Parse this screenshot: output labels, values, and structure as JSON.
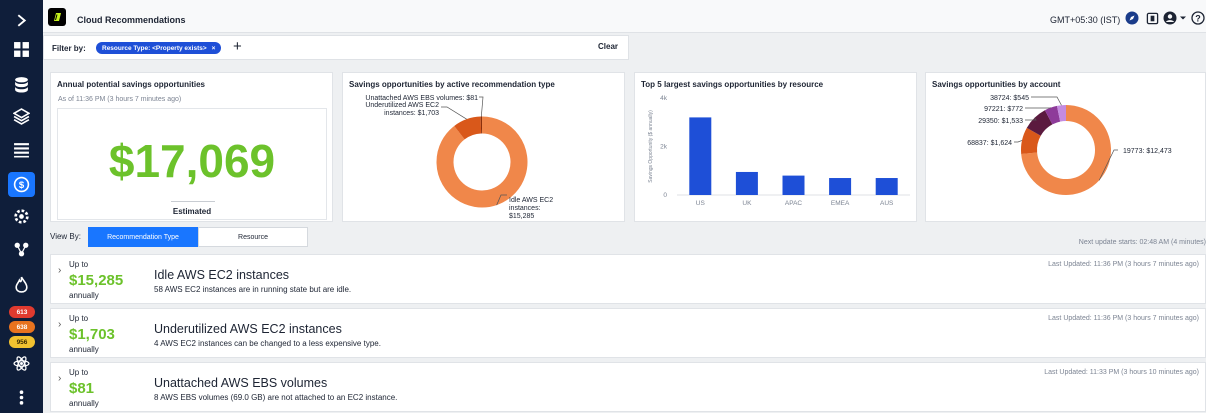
{
  "app": {
    "title": "Cloud Recommendations",
    "timezone": "GMT+05:30 (IST)"
  },
  "rail": {
    "items": [
      "expand-icon",
      "dashboard-icon",
      "database-icon",
      "layers-icon",
      "list-icon",
      "savings-icon",
      "settings-gear-icon",
      "topology-icon",
      "fire-icon"
    ],
    "badges": [
      {
        "label": "613",
        "color": "#e03a2f"
      },
      {
        "label": "638",
        "color": "#e8731f"
      },
      {
        "label": "956",
        "color": "#f2c230"
      }
    ]
  },
  "filter": {
    "label": "Filter by:",
    "chip": "Resource Type: <Property exists>",
    "chip_close": "×",
    "add": "+",
    "clear": "Clear"
  },
  "cards": {
    "annual": {
      "title": "Annual potential savings opportunities",
      "as_of": "As of 11:36 PM (3 hours 7 minutes ago)",
      "value": "$17,069",
      "caption": "Estimated"
    },
    "by_type": {
      "title": "Savings opportunities by active recommendation type"
    },
    "top5": {
      "title": "Top 5 largest savings opportunities by resource"
    },
    "by_account": {
      "title": "Savings opportunities by account"
    }
  },
  "chart_data": [
    {
      "type": "pie",
      "title": "Savings opportunities by active recommendation type",
      "slices": [
        {
          "label": "Idle AWS EC2 instances: $15,285",
          "value": 15285,
          "color": "#f0874a"
        },
        {
          "label": "Underutilized AWS EC2 instances: $1,703",
          "value": 1703,
          "color": "#d9581a"
        },
        {
          "label": "Unattached AWS EBS volumes: $81",
          "value": 81,
          "color": "#8a2f0c"
        }
      ]
    },
    {
      "type": "bar",
      "title": "Top 5 largest savings opportunities by resource",
      "categories": [
        "US",
        "UK",
        "APAC",
        "EMEA",
        "AUS"
      ],
      "values": [
        3200,
        950,
        800,
        700,
        700
      ],
      "ylabel": "Savings Opportunity ($ annually)",
      "ylim": [
        0,
        4000
      ],
      "yticks": [
        {
          "v": 0,
          "label": "0"
        },
        {
          "v": 2000,
          "label": "2k"
        },
        {
          "v": 4000,
          "label": "4k"
        }
      ],
      "color": "#1e4fd7"
    },
    {
      "type": "pie",
      "title": "Savings opportunities by account",
      "slices": [
        {
          "label": "19773: $12,473",
          "value": 12473,
          "color": "#f0874a"
        },
        {
          "label": "68837: $1,624",
          "value": 1624,
          "color": "#d9581a"
        },
        {
          "label": "29350: $1,533",
          "value": 1533,
          "color": "#5b1a3f"
        },
        {
          "label": "97221: $772",
          "value": 772,
          "color": "#8e3b9a"
        },
        {
          "label": "38724: $545",
          "value": 545,
          "color": "#c48be0"
        }
      ]
    }
  ],
  "view_by": {
    "label": "View By:",
    "options": [
      "Recommendation Type",
      "Resource"
    ],
    "selected": "Recommendation Type"
  },
  "next_update": "Next update starts: 02:48 AM (4 minutes)",
  "recommendations": [
    {
      "upto": "Up to",
      "amount": "$15,285",
      "period": "annually",
      "title": "Idle AWS EC2 instances",
      "desc": "58 AWS EC2 instances are in running state but are idle.",
      "updated": "Last Updated: 11:36 PM (3 hours 7 minutes ago)"
    },
    {
      "upto": "Up to",
      "amount": "$1,703",
      "period": "annually",
      "title": "Underutilized AWS EC2 instances",
      "desc": "4 AWS EC2 instances can be changed to a less expensive type.",
      "updated": "Last Updated: 11:36 PM (3 hours 7 minutes ago)"
    },
    {
      "upto": "Up to",
      "amount": "$81",
      "period": "annually",
      "title": "Unattached AWS EBS volumes",
      "desc": "8 AWS EBS volumes (69.0 GB) are not attached to an EC2 instance.",
      "updated": "Last Updated: 11:33 PM (3 hours 10 minutes ago)"
    }
  ]
}
